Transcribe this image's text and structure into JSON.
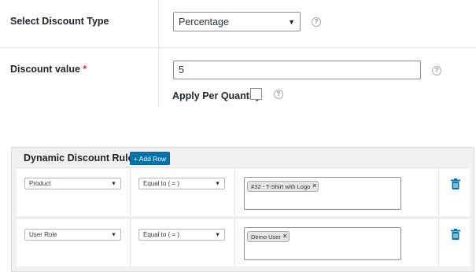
{
  "discount_type": {
    "label": "Select Discount Type",
    "selected": "Percentage"
  },
  "discount_value": {
    "label": "Discount value",
    "required_mark": "*",
    "value": "5"
  },
  "apply_per_quantity": {
    "label": "Apply Per Quantity",
    "checked": false
  },
  "dynamic_rule": {
    "title": "Dynamic Discount Rule",
    "add_row_label": "+ Add Row",
    "rows": [
      {
        "field": "Product",
        "condition": "Equal to ( = )",
        "tag": "#32 - T-Shirt with Logo"
      },
      {
        "field": "User Role",
        "condition": "Equal to ( = )",
        "tag": "Demo User"
      }
    ]
  },
  "icons": {
    "help": "help-circle-icon",
    "delete": "trash-icon",
    "caret": "caret-down-icon"
  },
  "colors": {
    "accent": "#0073aa",
    "required": "#dc3232"
  }
}
